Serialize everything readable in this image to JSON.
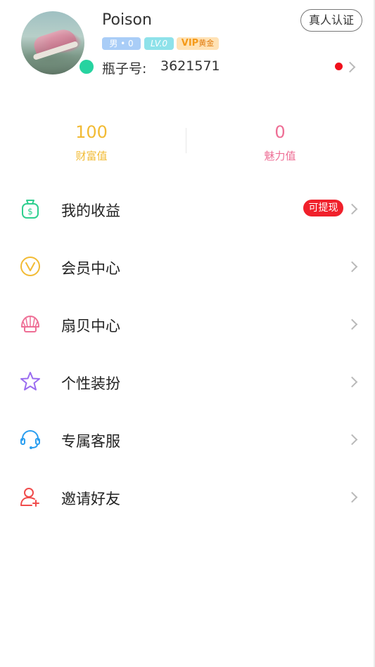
{
  "profile": {
    "username": "Poison",
    "gender_tag": "男 • 0",
    "level_tag": "LV.0",
    "vip_tag": "VIP",
    "vip_sub": "黄金",
    "bottle_label": "瓶子号:",
    "bottle_number": "3621571",
    "verify_button": "真人认证"
  },
  "stats": {
    "wealth_value": "100",
    "wealth_label": "财富值",
    "charm_value": "0",
    "charm_label": "魅力值"
  },
  "menu": [
    {
      "label": "我的收益",
      "icon": "money-bag-icon",
      "color": "#2fcf8f",
      "badge": "可提现"
    },
    {
      "label": "会员中心",
      "icon": "vip-v-icon",
      "color": "#f2bb34"
    },
    {
      "label": "扇贝中心",
      "icon": "shell-icon",
      "color": "#ee6e95"
    },
    {
      "label": "个性装扮",
      "icon": "star-icon",
      "color": "#9a6cf0"
    },
    {
      "label": "专属客服",
      "icon": "headset-icon",
      "color": "#2a9ef0"
    },
    {
      "label": "邀请好友",
      "icon": "add-user-icon",
      "color": "#f04b4b"
    }
  ],
  "colors": {
    "wealth": "#f2bb34",
    "charm": "#ee6e95",
    "badge": "#f0202b",
    "online": "#27d3a0"
  }
}
